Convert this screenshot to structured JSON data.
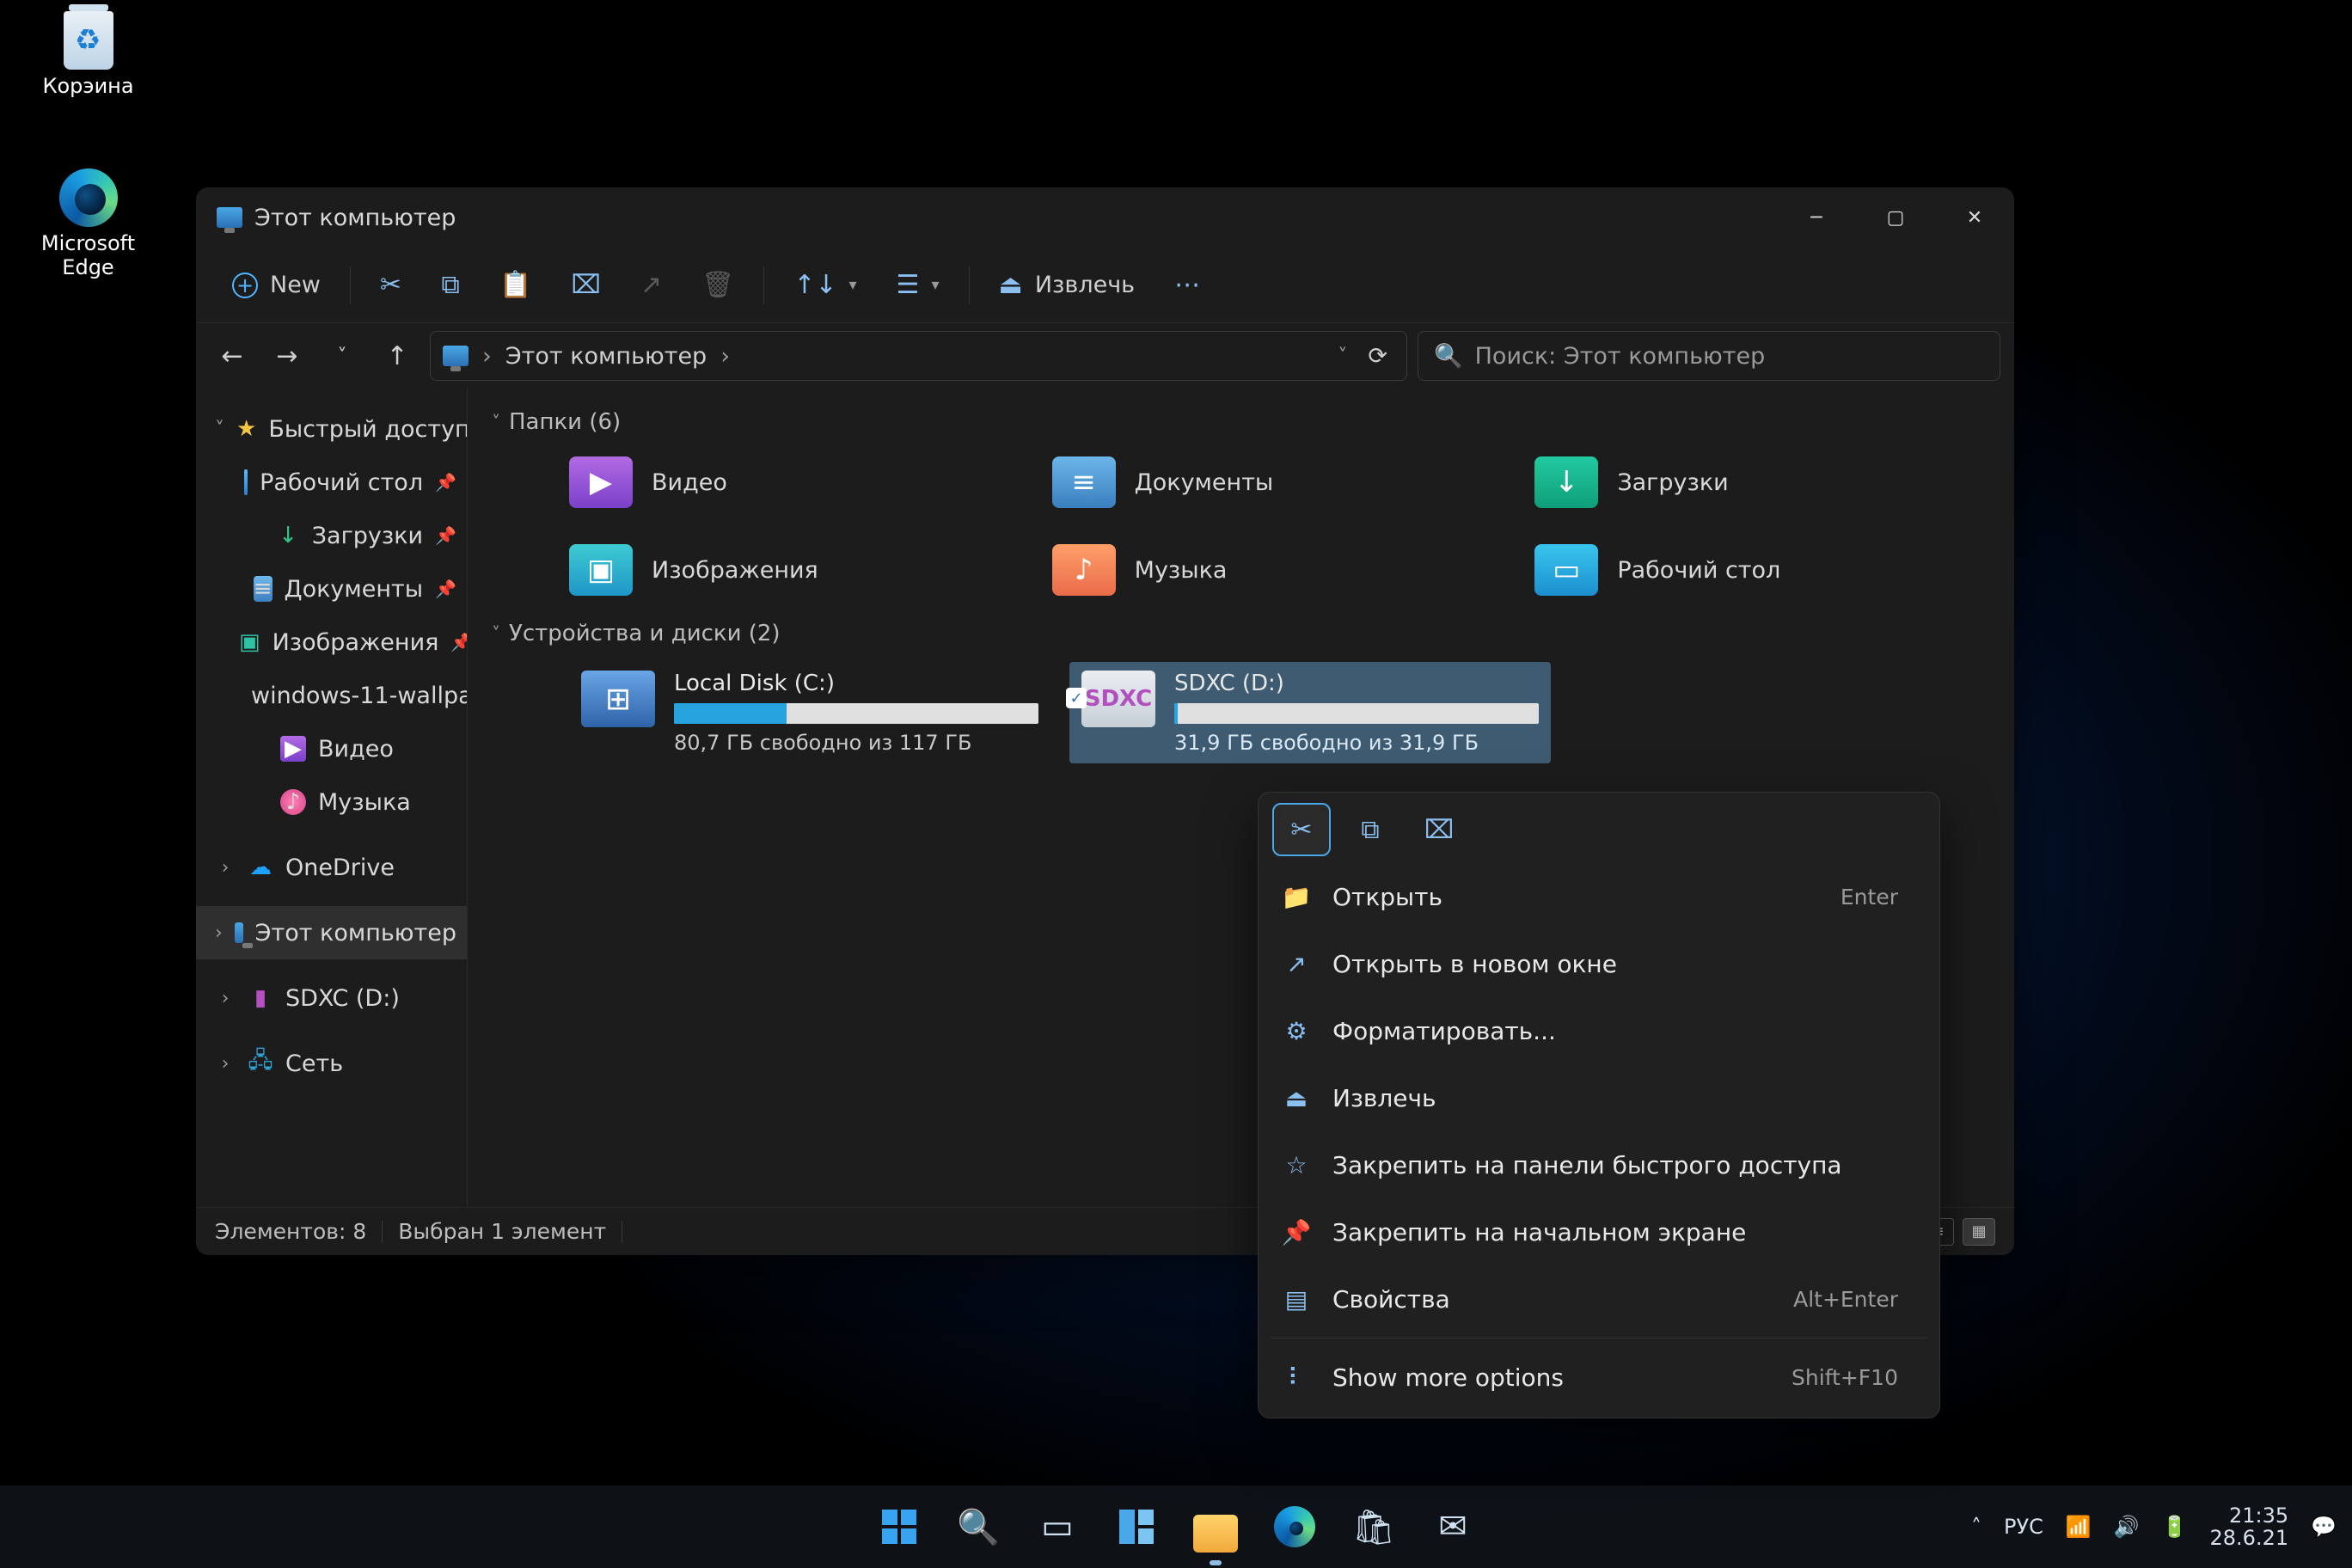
{
  "desktop": {
    "recycle": "Корэина",
    "edge_l1": "Microsoft",
    "edge_l2": "Edge"
  },
  "titlebar": {
    "title": "Этот компьютер"
  },
  "toolbar": {
    "new": "New",
    "eject": "Извлечь"
  },
  "address": {
    "location": "Этот компьютер"
  },
  "search": {
    "placeholder": "Поиск: Этот компьютер"
  },
  "sidebar": {
    "quick": "Быстрый доступ",
    "items": [
      {
        "label": "Рабочий стол",
        "pin": true,
        "ic": "folder-b"
      },
      {
        "label": "Загрузки",
        "pin": true,
        "ic": "dl"
      },
      {
        "label": "Документы",
        "pin": true,
        "ic": "doc"
      },
      {
        "label": "Изображения",
        "pin": true,
        "ic": "img"
      },
      {
        "label": "windows-11-wallpa",
        "pin": false,
        "ic": "folder"
      },
      {
        "label": "Видео",
        "pin": false,
        "ic": "vid"
      },
      {
        "label": "Музыка",
        "pin": false,
        "ic": "mus"
      }
    ],
    "onedrive": "OneDrive",
    "thispc": "Этот компьютер",
    "sdxc": "SDXC (D:)",
    "network": "Сеть"
  },
  "groups": {
    "folders": {
      "title": "Папки (6)"
    },
    "drives": {
      "title": "Устройства и диски (2)"
    }
  },
  "folders": [
    {
      "label": "Видео",
      "ic": "vid",
      "g": "▶"
    },
    {
      "label": "Документы",
      "ic": "doc",
      "g": "≡"
    },
    {
      "label": "Загрузки",
      "ic": "dl",
      "g": "↓"
    },
    {
      "label": "Изображения",
      "ic": "img",
      "g": "▣"
    },
    {
      "label": "Музыка",
      "ic": "mus",
      "g": "♪"
    },
    {
      "label": "Рабочий стол",
      "ic": "desk",
      "g": "▭"
    }
  ],
  "drives": {
    "c": {
      "name": "Local Disk (C:)",
      "free": "80,7 ГБ свободно из 117 ГБ",
      "fill": 31
    },
    "d": {
      "name": "SDXC (D:)",
      "label": "SDXC",
      "free": "31,9 ГБ свободно из 31,9 ГБ",
      "fill": 1
    }
  },
  "status": {
    "items": "Элементов: 8",
    "selected": "Выбран 1 элемент"
  },
  "context": {
    "open": {
      "label": "Открыть",
      "hot": "Enter"
    },
    "openwin": "Открыть в новом окне",
    "format": "Форматировать...",
    "eject": "Извлечь",
    "pinqa": "Закрепить на панели быстрого доступа",
    "pinstart": "Закрепить на начальном экране",
    "props": {
      "label": "Свойства",
      "hot": "Alt+Enter"
    },
    "more": {
      "label": "Show more options",
      "hot": "Shift+F10"
    }
  },
  "tray": {
    "lang": "РУС",
    "time": "21:35",
    "date": "28.6.21"
  }
}
